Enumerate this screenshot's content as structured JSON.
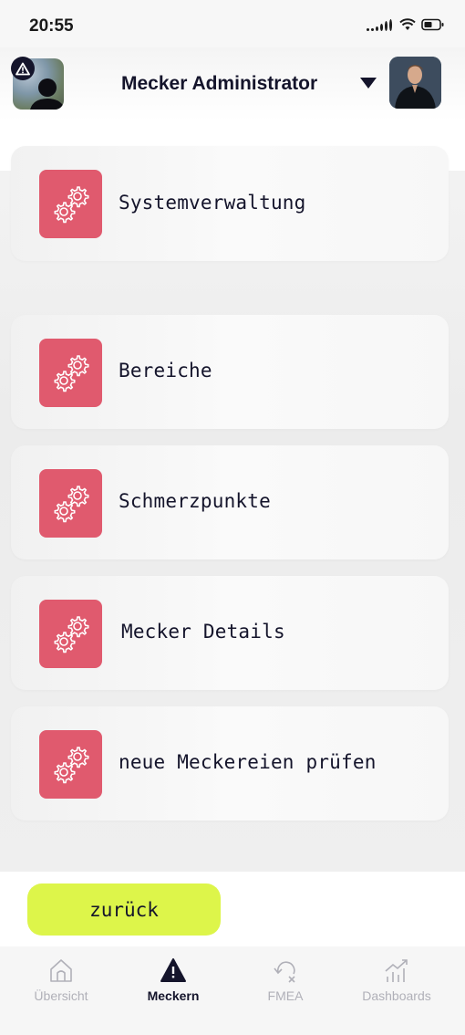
{
  "status_bar": {
    "time": "20:55"
  },
  "header": {
    "user_name": "Mecker Administrator"
  },
  "menu": {
    "items": [
      {
        "label": "Systemverwaltung"
      },
      {
        "label": "Bereiche"
      },
      {
        "label": "Schmerzpunkte"
      },
      {
        "label": "Mecker Details"
      },
      {
        "label": "neue Meckereien prüfen"
      }
    ]
  },
  "back_button": {
    "label": "zurück"
  },
  "tabbar": {
    "tabs": [
      {
        "label": "Übersicht",
        "icon": "home-icon",
        "active": false
      },
      {
        "label": "Meckern",
        "icon": "warning-icon",
        "active": true
      },
      {
        "label": "FMEA",
        "icon": "undo-x-icon",
        "active": false
      },
      {
        "label": "Dashboards",
        "icon": "chart-icon",
        "active": false
      }
    ]
  },
  "colors": {
    "accent_tile": "#e05a6e",
    "back_button": "#ddf54a",
    "text_dark": "#14142b"
  }
}
